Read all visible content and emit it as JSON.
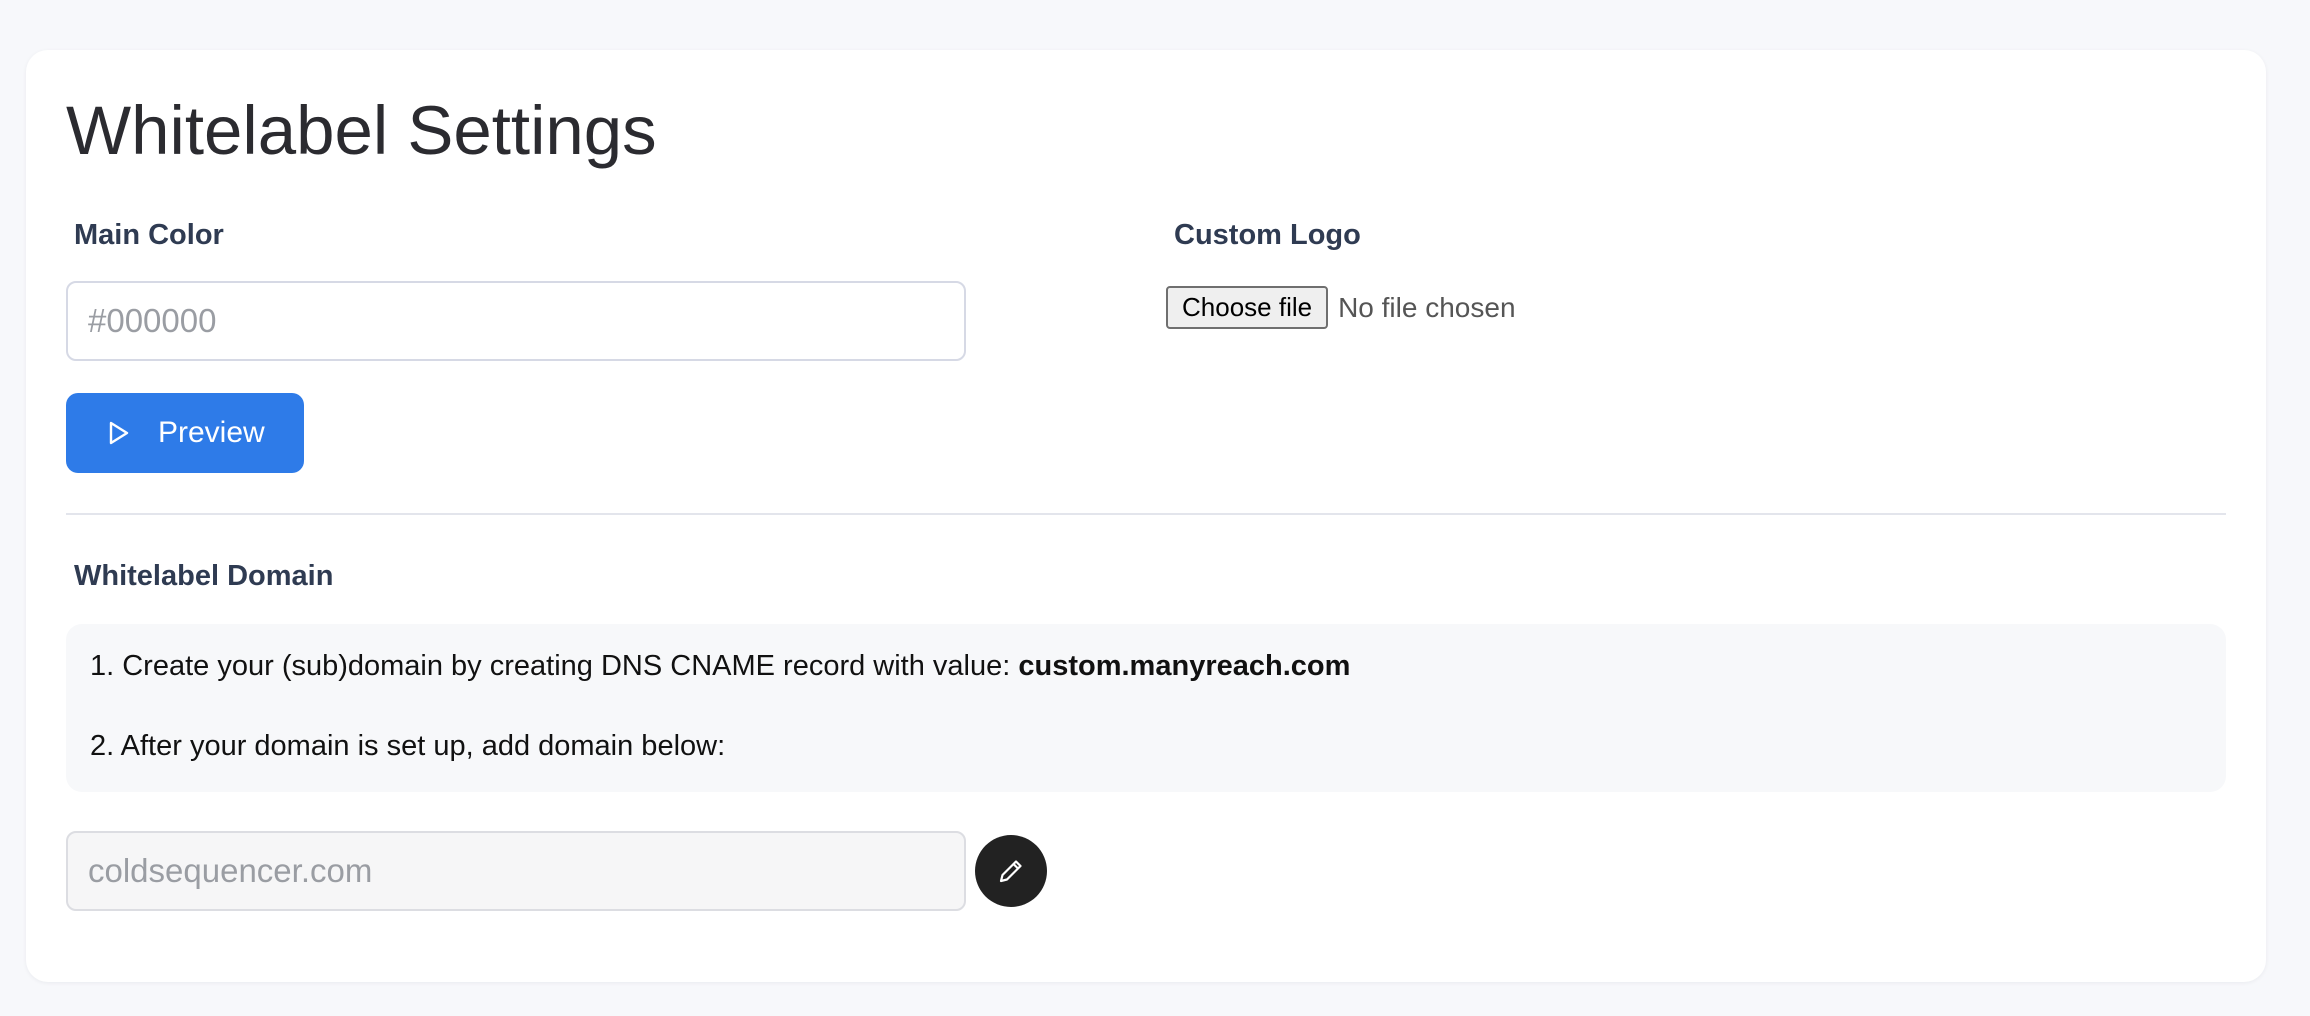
{
  "page": {
    "title": "Whitelabel Settings"
  },
  "main_color": {
    "label": "Main Color",
    "placeholder": "#000000",
    "value": ""
  },
  "preview_button": {
    "label": "Preview",
    "icon": "play-outline-icon"
  },
  "custom_logo": {
    "label": "Custom Logo",
    "choose_file_label": "Choose file",
    "file_status": "No file chosen"
  },
  "whitelabel_domain": {
    "label": "Whitelabel Domain",
    "step1_text": "1. Create your (sub)domain by creating DNS CNAME record with value: ",
    "cname_value": "custom.manyreach.com",
    "step2_text": "2. After your domain is set up, add domain below:",
    "domain_placeholder": "coldsequencer.com",
    "domain_value": "",
    "edit_icon": "pencil-icon"
  },
  "colors": {
    "accent": "#2e7be8",
    "background": "#f7f8fb",
    "card": "#ffffff",
    "edit_button": "#222222"
  }
}
